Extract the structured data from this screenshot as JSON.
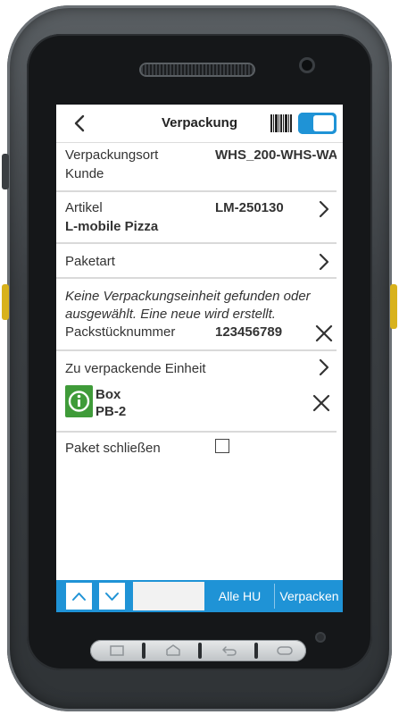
{
  "header": {
    "title": "Verpackung"
  },
  "rows": {
    "packing_location": {
      "label_line1": "Verpackungsort",
      "label_line2": "Kunde",
      "value": "WHS_200-WHS-WA"
    },
    "article": {
      "label": "Artikel",
      "name": "L-mobile Pizza",
      "value": "LM-250130"
    },
    "package_type": {
      "label": "Paketart"
    },
    "info_message": {
      "line1": "Keine Verpackungseinheit gefunden oder",
      "line2": "ausgewählt. Eine neue wird erstellt."
    },
    "package_number": {
      "label": "Packstücknummer",
      "value": "123456789"
    },
    "unit_to_pack": {
      "label": "Zu verpackende Einheit",
      "item_name": "Box",
      "item_code": "PB-2"
    },
    "close_package": {
      "label": "Paket schließen",
      "checked": false
    }
  },
  "bottom_bar": {
    "all_hu": "Alle HU",
    "pack": "Verpacken"
  },
  "colors": {
    "accent": "#1f93d6",
    "info_green": "#3f9b39",
    "divider": "#d9d9d9"
  }
}
